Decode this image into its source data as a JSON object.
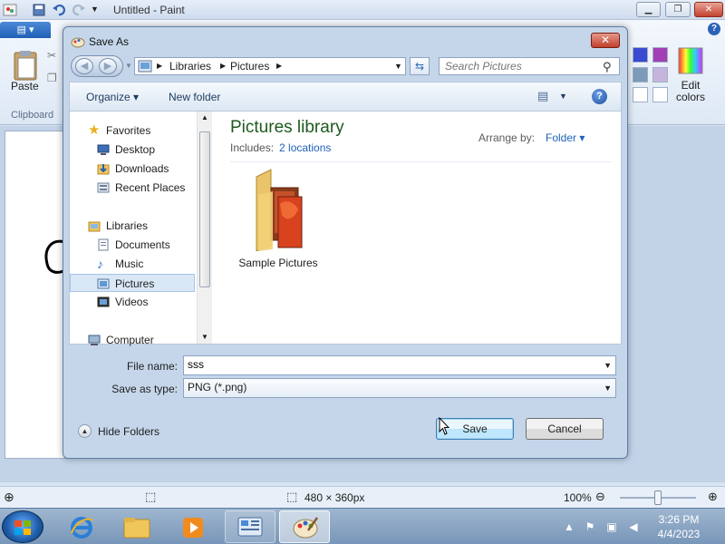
{
  "paint": {
    "title": "Untitled - Paint",
    "minimize_icon": "minimize-icon",
    "maximize_icon": "maximize-icon",
    "close_icon": "close-icon",
    "file_tab_icon": "menu-icon",
    "paste_label": "Paste",
    "clipboard_group": "Clipboard",
    "edit_colors_label": "Edit colors",
    "help_icon": "?",
    "status": {
      "canvas_size": "480 × 360px",
      "zoom": "100%"
    },
    "palette": [
      "#3a4bd1",
      "#a33fb5",
      "#7d9ab8",
      "#c7b4dc",
      "#ffffff",
      "#ffffff"
    ]
  },
  "dialog": {
    "title": "Save As",
    "close_glyph": "✕",
    "address": {
      "path": [
        "Libraries",
        "Pictures"
      ]
    },
    "search": {
      "placeholder": "Search Pictures"
    },
    "toolbar": {
      "organize": "Organize ▾",
      "new_folder": "New folder"
    },
    "nav": {
      "favorites": "Favorites",
      "favorites_items": [
        "Desktop",
        "Downloads",
        "Recent Places"
      ],
      "libraries": "Libraries",
      "libraries_items": [
        "Documents",
        "Music",
        "Pictures",
        "Videos"
      ],
      "computer": "Computer",
      "selected": "Pictures"
    },
    "content": {
      "title": "Pictures library",
      "includes_label": "Includes:",
      "includes_link": "2 locations",
      "arrange_label": "Arrange by:",
      "arrange_value": "Folder ▾",
      "items": [
        {
          "label": "Sample Pictures",
          "icon": "folder-pictures-icon"
        }
      ]
    },
    "form": {
      "file_name_label": "File name:",
      "file_name_value": "sss",
      "save_type_label": "Save as type:",
      "save_type_value": "PNG (*.png)"
    },
    "footer": {
      "hide_folders": "Hide Folders",
      "save": "Save",
      "cancel": "Cancel"
    }
  },
  "taskbar": {
    "time": "3:26 PM",
    "date": "4/4/2023"
  }
}
